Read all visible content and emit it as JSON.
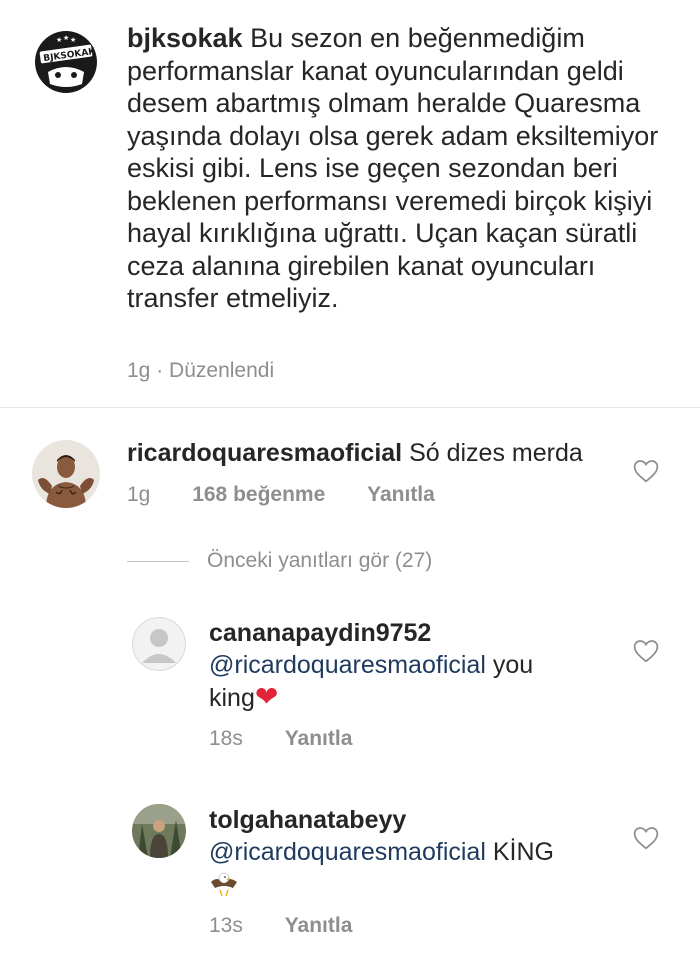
{
  "post": {
    "username": "bjksokak",
    "text": "Bu sezon en beğenmediğim performanslar kanat oyuncularından geldi desem abartmış olmam heralde Quaresma yaşında dolayı olsa gerek adam eksiltemiyor eskisi gibi. Lens ise geçen sezondan beri beklenen performansı veremedi birçok kişiyi hayal kırıklığına uğrattı. Uçan kaçan süratli ceza alanına girebilen kanat oyuncuları transfer etmeliyiz.",
    "time": "1g",
    "separator": "·",
    "edited": "Düzenlendi",
    "avatar_text": "BJKSOKAK"
  },
  "comment": {
    "username": "ricardoquaresmaoficial",
    "text": "Só dizes merda",
    "time": "1g",
    "likes": "168 beğenme",
    "reply": "Yanıtla"
  },
  "view_replies": "Önceki yanıtları gör (27)",
  "replies": [
    {
      "username": "cananapaydin9752",
      "mention": "@ricardoquaresmaoficial",
      "text_1": "you",
      "text_2": "king",
      "emoji": "❤",
      "time": "18s",
      "reply": "Yanıtla"
    },
    {
      "username": "tolgahanatabeyy",
      "mention": "@ricardoquaresmaoficial",
      "text_1": "KİNG",
      "emoji": "eagle",
      "time": "13s",
      "reply": "Yanıtla"
    }
  ],
  "icons": {
    "heart": "heart-outline-icon"
  },
  "colors": {
    "text": "#262626",
    "secondary": "#8e8e8e",
    "mention": "#1e3a5f",
    "heart_emoji": "#e0243a"
  }
}
